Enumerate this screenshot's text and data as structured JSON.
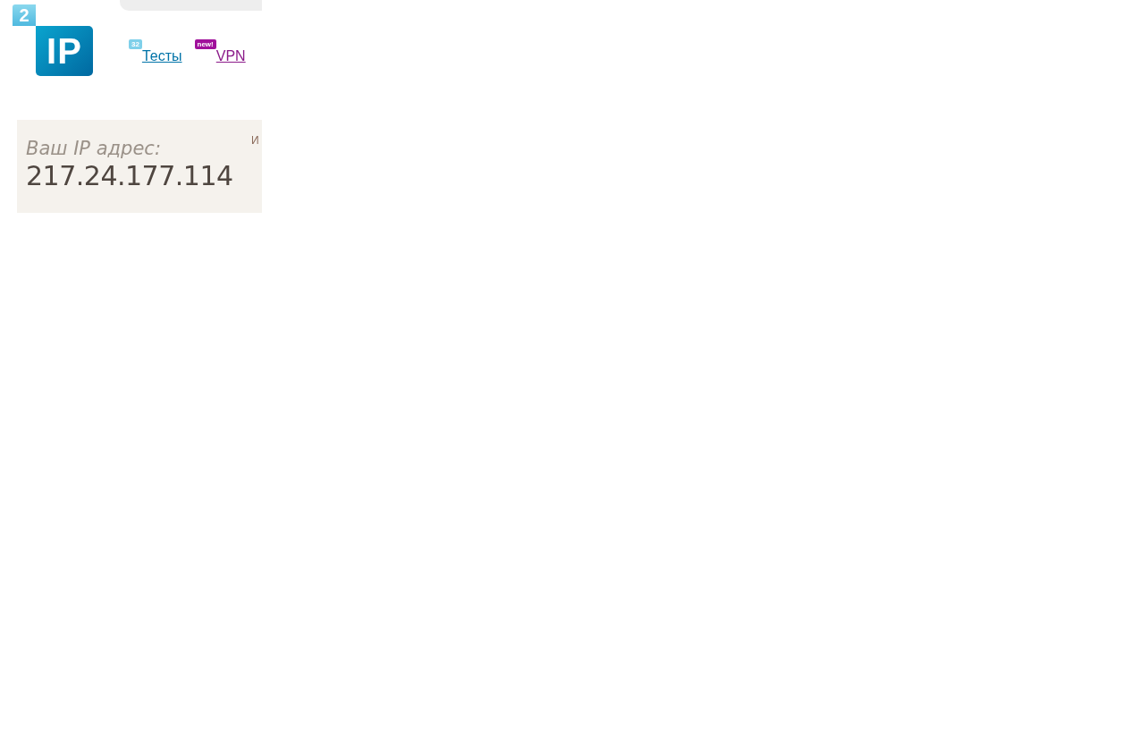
{
  "logo": {
    "digit": "2",
    "text": "IP"
  },
  "nav": [
    {
      "label": "Тесты",
      "badge": "32",
      "color": "#7fd0ea",
      "visited": false
    },
    {
      "label": "VPN",
      "badge": "new!",
      "color": "#a0119b",
      "visited": true
    }
  ],
  "ip_panel": {
    "label": "Ваш IP адрес:",
    "ip": "217.24.177.114",
    "side_text": "И"
  }
}
